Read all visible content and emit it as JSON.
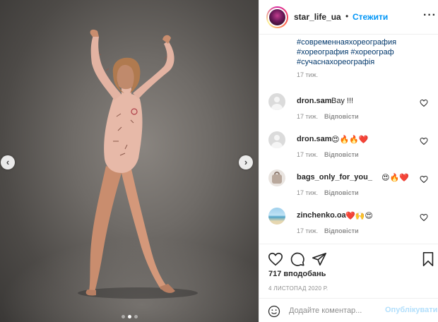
{
  "photo": {
    "prev_arrow": "‹",
    "next_arrow": "›",
    "slide_count": 3,
    "active_slide": 2
  },
  "header": {
    "username": "star_life_ua",
    "separator": "•",
    "follow_label": "Стежити",
    "more_label": "···"
  },
  "caption": {
    "hashtags": [
      "#современнаяхореография",
      "#хореография #хореограф",
      "#сучаснахореографія"
    ],
    "time": "17 тиж."
  },
  "comments": [
    {
      "user": "dron.sam",
      "text": "Вау !!!",
      "time": "17 тиж.",
      "reply": "Відповісти",
      "avatar": "default"
    },
    {
      "user": "dron.sam",
      "text": "😍🔥🔥❤️",
      "time": "17 тиж.",
      "reply": "Відповісти",
      "avatar": "default"
    },
    {
      "user": "bags_only_for_you_",
      "text": "😍🔥❤️",
      "time": "17 тиж.",
      "reply": "Відповісти",
      "avatar": "bags"
    },
    {
      "user": "zinchenko.oa",
      "text": "❤️🙌😍",
      "time": "17 тиж.",
      "reply": "Відповісти",
      "avatar": "sea"
    }
  ],
  "actions": {
    "likes": "717 вподобань",
    "date": "4 ЛИСТОПАД 2020 Р."
  },
  "add_comment": {
    "placeholder": "Додайте коментар...",
    "post_label": "Опублікувати"
  },
  "colors": {
    "link_blue": "#0095f6",
    "hashtag": "#00376b",
    "muted": "#8e8e8e",
    "post_disabled": "#b2dffc"
  }
}
